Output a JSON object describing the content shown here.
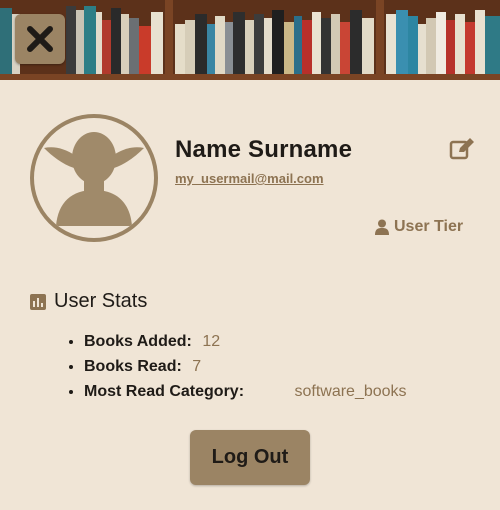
{
  "header": {
    "close_icon": "close-icon"
  },
  "profile": {
    "name": "Name Surname",
    "email": "my_usermail@mail.com",
    "edit_icon": "edit-icon",
    "tier_label": "User Tier",
    "tier_icon": "user-icon"
  },
  "stats": {
    "title": "User Stats",
    "icon": "chart-icon",
    "items": [
      {
        "label": "Books Added:",
        "value": "12"
      },
      {
        "label": "Books Read:",
        "value": "7"
      },
      {
        "label": "Most Read Category:",
        "value": "software_books"
      }
    ]
  },
  "actions": {
    "logout_label": "Log Out"
  },
  "colors": {
    "background": "#f0e5d6",
    "accent": "#9b8464",
    "accent_text": "#8d7352",
    "text": "#1f1b17"
  }
}
